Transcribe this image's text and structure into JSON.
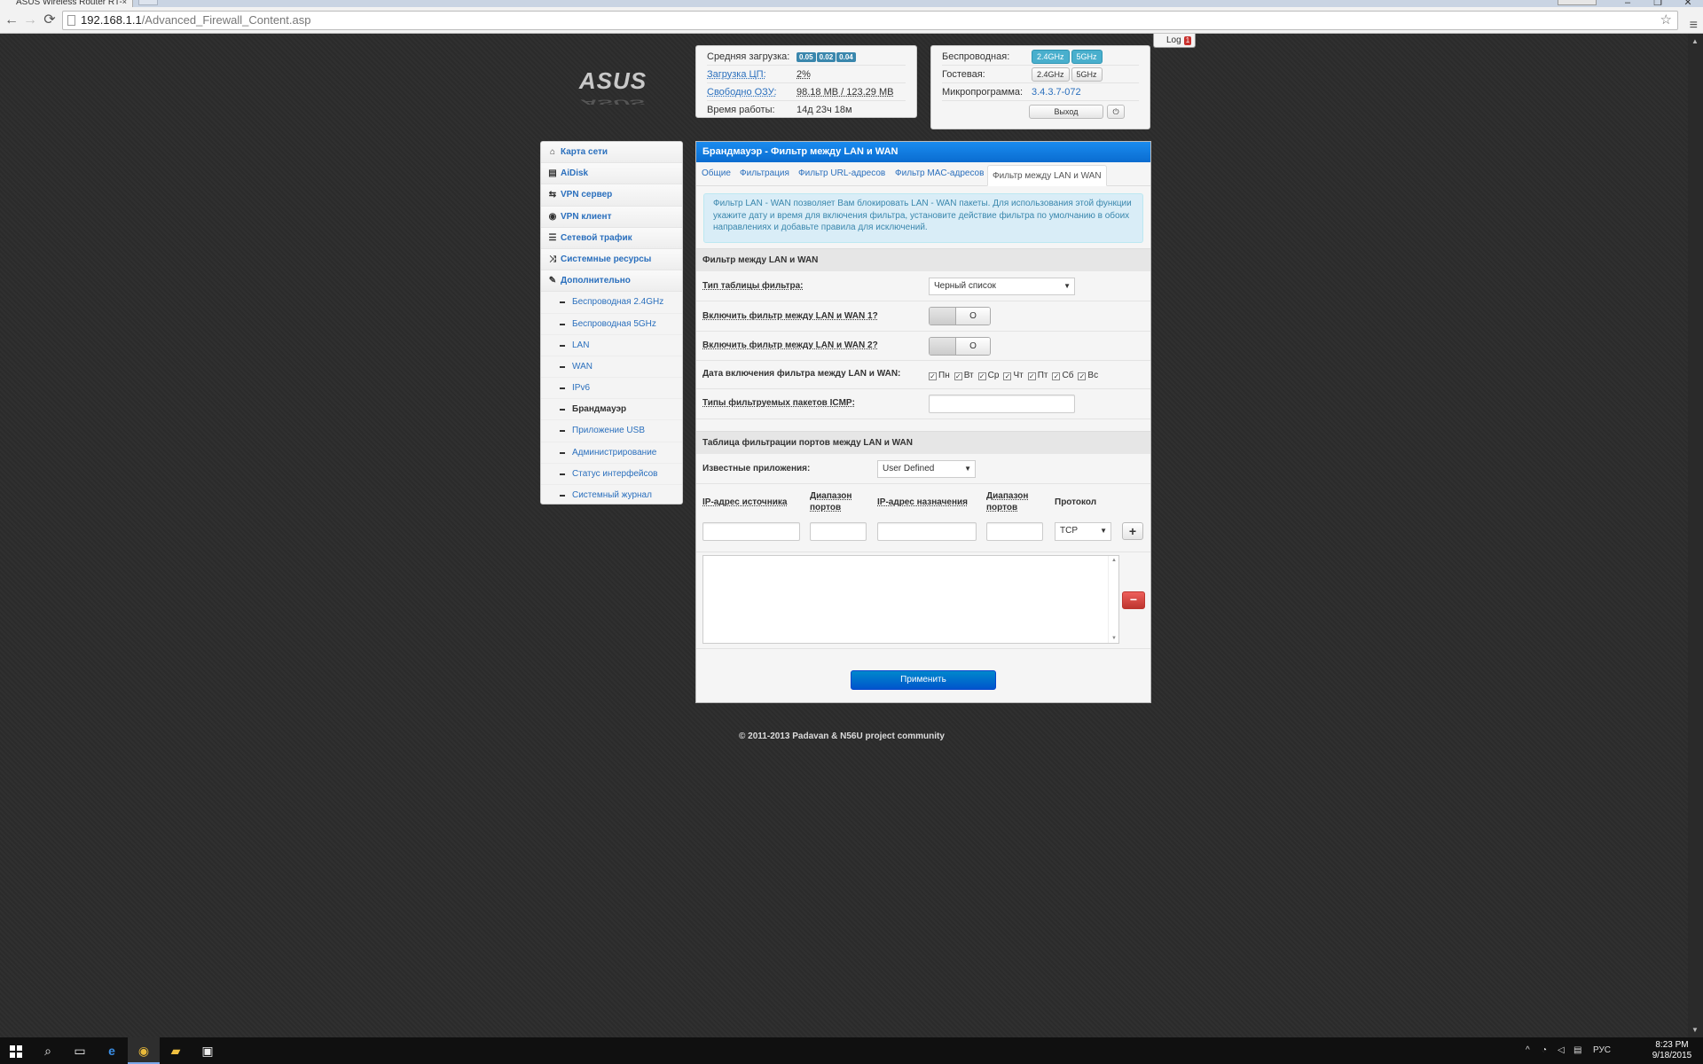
{
  "browser": {
    "tab_title": "ASUS Wireless Router RT-",
    "tab_close": "×",
    "url_host": "192.168.1.1",
    "url_path": "/Advanced_Firewall_Content.asp",
    "back_glyph": "←",
    "forward_glyph": "→",
    "reload_glyph": "⟳",
    "star_glyph": "☆",
    "menu_glyph": "≡",
    "window_buttons": [
      "–",
      "❐",
      "✕"
    ]
  },
  "log_button": {
    "label": "Log",
    "count": "1"
  },
  "status_left": {
    "rows": [
      {
        "label": "Средняя загрузка:",
        "badges": [
          "0.05",
          "0.02",
          "0.04"
        ]
      },
      {
        "label": "Загрузка ЦП:",
        "value": "2%"
      },
      {
        "label": "Свободно ОЗУ:",
        "value": "98.18 MB / 123.29 MB"
      },
      {
        "label": "Время работы:",
        "value": "14д 23ч 18м"
      }
    ]
  },
  "status_right": {
    "wireless_label": "Беспроводная:",
    "guest_label": "Гостевая:",
    "firmware_label": "Микропрограмма:",
    "firmware_value": "3.4.3.7-072",
    "band_24": "2.4GHz",
    "band_5": "5GHz",
    "logout": "Выход",
    "power_glyph": "⏻"
  },
  "sidebar": {
    "items": [
      {
        "label": "Карта сети",
        "icon": "home-icon",
        "glyph": "⌂"
      },
      {
        "label": "AiDisk",
        "icon": "disk-icon",
        "glyph": "▤"
      },
      {
        "label": "VPN сервер",
        "icon": "retweet-icon",
        "glyph": "⇆"
      },
      {
        "label": "VPN клиент",
        "icon": "globe-icon",
        "glyph": "◉"
      },
      {
        "label": "Сетевой трафик",
        "icon": "list-icon",
        "glyph": "☰"
      },
      {
        "label": "Системные ресурсы",
        "icon": "random-icon",
        "glyph": "⤨"
      },
      {
        "label": "Дополнительно",
        "icon": "wrench-icon",
        "glyph": "✎"
      }
    ],
    "subitems": [
      "Беспроводная 2.4GHz",
      "Беспроводная 5GHz",
      "LAN",
      "WAN",
      "IPv6",
      "Брандмауэр",
      "Приложение USB",
      "Администрирование",
      "Статус интерфейсов",
      "Системный журнал"
    ]
  },
  "main": {
    "title": "Брандмауэр - Фильтр между LAN и WAN",
    "tabs": [
      "Общие",
      "Фильтрация",
      "Фильтр URL-адресов",
      "Фильтр MAC-адресов",
      "Фильтр между LAN и WAN"
    ],
    "alert": "Фильтр LAN - WAN позволяет Вам блокировать LAN - WAN пакеты. Для использования этой функции укажите дату и время для включения фильтра, установите действие фильтра по умолчанию в обоих направлениях и добавьте правила для исключений.",
    "section1": "Фильтр между LAN и WAN",
    "filter_type_label": "Тип таблицы фильтра:",
    "filter_type_value": "Черный список",
    "enable1_label": "Включить фильтр между LAN и WAN 1?",
    "enable2_label": "Включить фильтр между LAN и WAN 2?",
    "toggle_glyph": "O",
    "date_label": "Дата включения фильтра между LAN и WAN:",
    "days": [
      "Пн",
      "Вт",
      "Ср",
      "Чт",
      "Пт",
      "Сб",
      "Вс"
    ],
    "check_glyph": "✓",
    "icmp_label": "Типы фильтруемых пакетов ICMP:",
    "section2": "Таблица фильтрации портов между LAN и WAN",
    "known_apps_label": "Известные приложения:",
    "known_apps_value": "User Defined",
    "cols": {
      "src_ip": "IP-адрес источника",
      "src_port": "Диапазон портов",
      "dst_ip": "IP-адрес назначения",
      "dst_port": "Диапазон портов",
      "protocol": "Протокол"
    },
    "protocol_value": "TCP",
    "plus_glyph": "+",
    "minus_glyph": "−",
    "apply": "Применить"
  },
  "footer": "© 2011-2013 Padavan & N56U project community",
  "taskbar": {
    "clock_time": "8:23 PM",
    "clock_date": "9/18/2015",
    "lang": "РУС"
  }
}
